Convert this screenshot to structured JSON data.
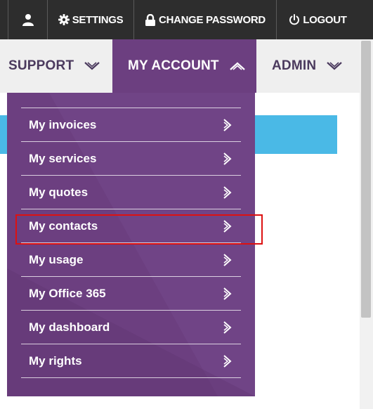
{
  "topbar": {
    "items": [
      {
        "label": "",
        "icon": "user-icon"
      },
      {
        "label": "SETTINGS",
        "icon": "gear-icon"
      },
      {
        "label": "CHANGE PASSWORD",
        "icon": "lock-icon"
      },
      {
        "label": "LOGOUT",
        "icon": "power-icon"
      }
    ]
  },
  "mainnav": {
    "items": [
      {
        "label": "SUPPORT",
        "icon": "chevron-down-icon"
      },
      {
        "label": "MY ACCOUNT",
        "icon": "chevron-up-icon"
      },
      {
        "label": "ADMIN",
        "icon": "chevron-down-icon"
      }
    ]
  },
  "dropdown": {
    "items": [
      {
        "label": "My invoices"
      },
      {
        "label": "My services"
      },
      {
        "label": "My quotes"
      },
      {
        "label": "My contacts"
      },
      {
        "label": "My usage"
      },
      {
        "label": "My Office 365"
      },
      {
        "label": "My dashboard"
      },
      {
        "label": "My rights"
      }
    ],
    "arrow_icon": "chevron-right-icon"
  },
  "colors": {
    "topbar_bg": "#2d2d2d",
    "nav_bg": "#efefef",
    "accent_purple": "#6c3f80",
    "nav_text": "#4b3a5e",
    "blue_banner": "#4ab9e6",
    "highlight": "#dd1111"
  }
}
